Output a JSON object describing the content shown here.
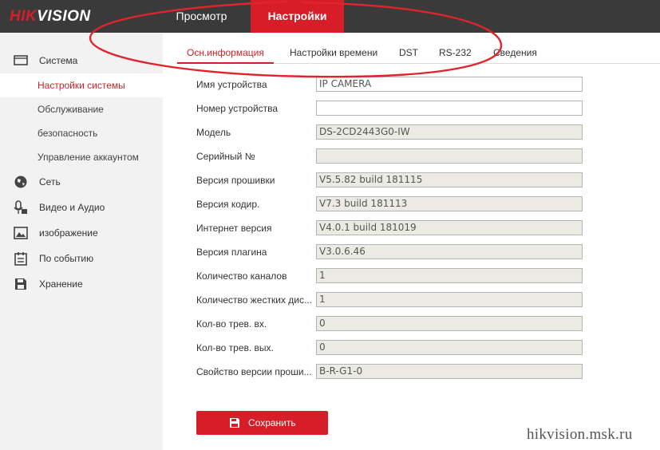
{
  "brand": {
    "logo_red": "HIK",
    "logo_white": "VISION"
  },
  "nav": {
    "preview": "Просмотр",
    "settings": "Настройки"
  },
  "sidebar": {
    "system": "Система",
    "system_sub": [
      "Настройки системы",
      "Обслуживание",
      "безопасность",
      "Управление аккаунтом"
    ],
    "network": "Сеть",
    "video_audio": "Видео и Аудио",
    "image": "изображение",
    "event": "По событию",
    "storage": "Хранение"
  },
  "tabs": [
    "Осн.информация",
    "Настройки времени",
    "DST",
    "RS-232",
    "Сведения"
  ],
  "fields": [
    {
      "label": "Имя устройства",
      "value": "IP CAMERA",
      "editable": true
    },
    {
      "label": "Номер устройства",
      "value": "",
      "editable": true
    },
    {
      "label": "Модель",
      "value": "DS-2CD2443G0-IW",
      "editable": false
    },
    {
      "label": "Серийный №",
      "value": "",
      "editable": false
    },
    {
      "label": "Версия прошивки",
      "value": "V5.5.82 build 181115",
      "editable": false
    },
    {
      "label": "Версия кодир.",
      "value": "V7.3 build 181113",
      "editable": false
    },
    {
      "label": "Интернет версия",
      "value": "V4.0.1 build 181019",
      "editable": false
    },
    {
      "label": "Версия плагина",
      "value": "V3.0.6.46",
      "editable": false
    },
    {
      "label": "Количество каналов",
      "value": "1",
      "editable": false
    },
    {
      "label": "Количество жестких дис...",
      "value": "1",
      "editable": false
    },
    {
      "label": "Кол-во трев. вх.",
      "value": "0",
      "editable": false
    },
    {
      "label": "Кол-во трев. вых.",
      "value": "0",
      "editable": false
    },
    {
      "label": "Свойство версии проши...",
      "value": "B-R-G1-0",
      "editable": false
    }
  ],
  "save_label": "Сохранить",
  "watermark": "hikvision.msk.ru",
  "colors": {
    "accent": "#d71e28",
    "header_bg": "#3a3a3a",
    "sidebar_bg": "#f2f2f2",
    "annotation": "#e0242c"
  }
}
